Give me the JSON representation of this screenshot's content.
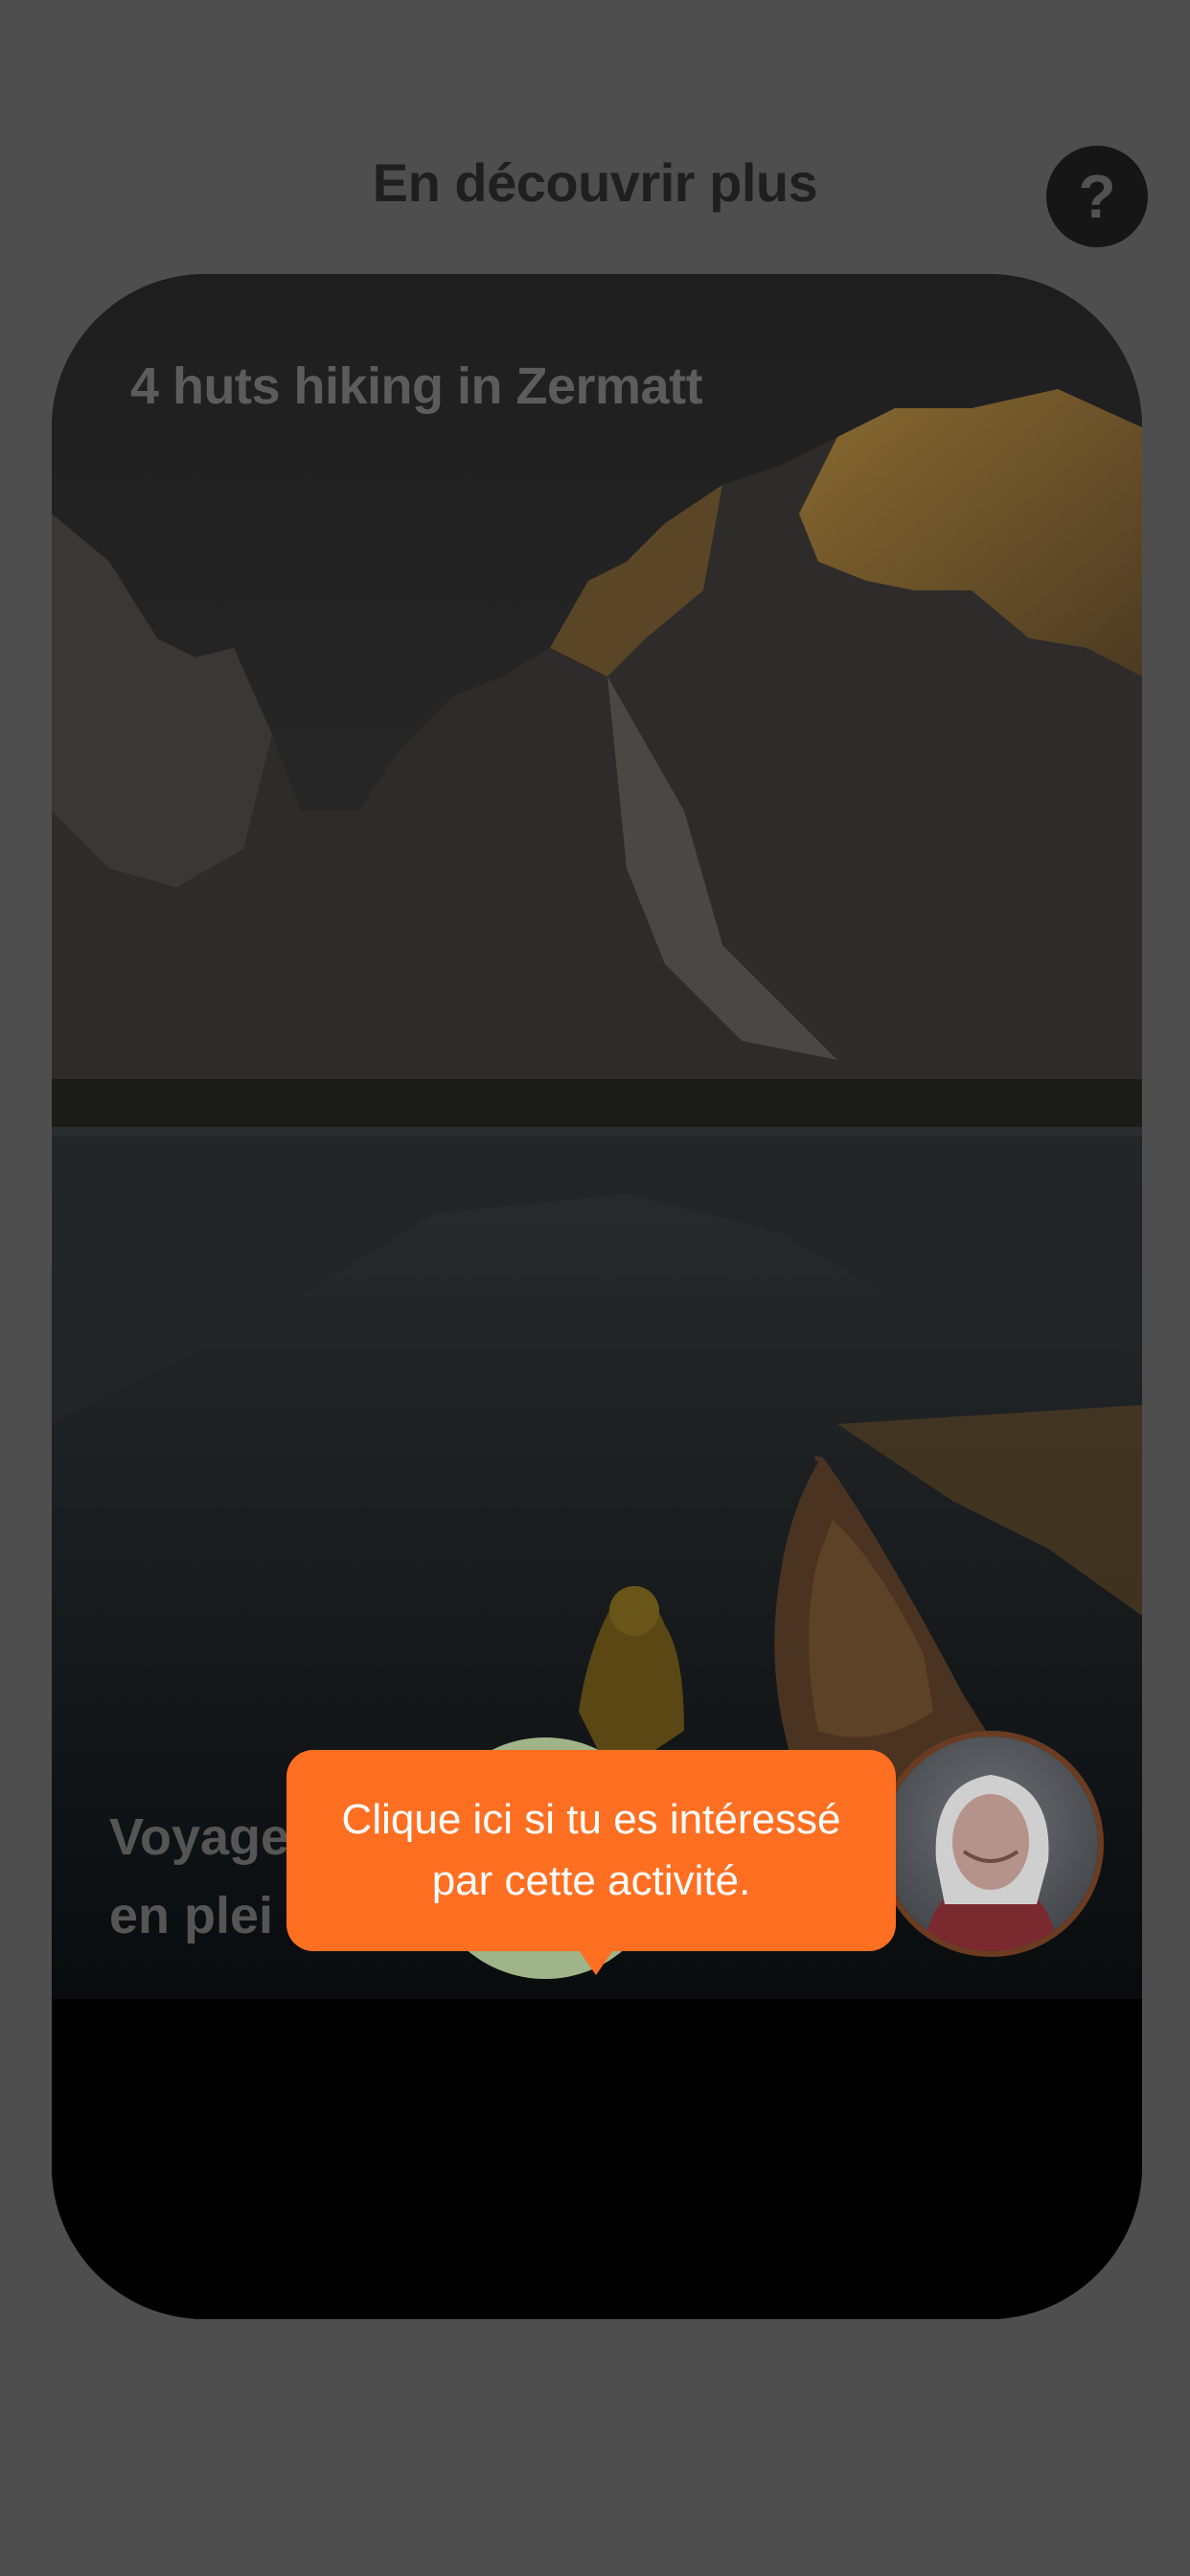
{
  "header": {
    "title": "En découvrir plus",
    "help_label": "?"
  },
  "card": {
    "title": "4 huts hiking in Zermatt",
    "subtitle": "Voyage\nen plei"
  },
  "tooltip": {
    "text": "Clique ici si tu es intéressé\npar cette activité."
  },
  "colors": {
    "overlay_bg": "#4e4e4e",
    "tooltip": "#ff6f22",
    "like_button": "#9fb488",
    "dismiss_button": "#5c3811"
  }
}
